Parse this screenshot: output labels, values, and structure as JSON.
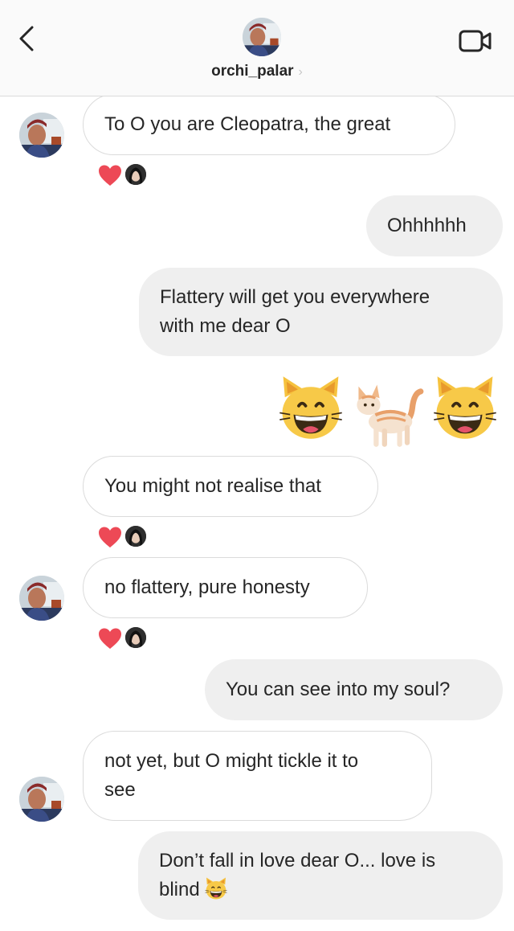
{
  "header": {
    "username": "orchi_palar",
    "chevron": "›",
    "back_icon": "chevron-left-icon",
    "video_icon": "video-camera-icon"
  },
  "colors": {
    "incoming_bubble": "#ffffff",
    "outgoing_bubble": "#efefef",
    "heart": "#ed4956"
  },
  "messages": [
    {
      "side": "in",
      "text": "To O you are Cleopatra, the great",
      "reaction": "heart"
    },
    {
      "side": "out",
      "text": "Ohhhhhh"
    },
    {
      "side": "out",
      "lines": [
        "Flattery will get you everywhere",
        "with me dear O"
      ]
    },
    {
      "side": "out",
      "emojis": [
        "grinning-cat-emoji",
        "cat-emoji",
        "grinning-cat-emoji"
      ]
    },
    {
      "side": "in",
      "text": "You might not realise that",
      "reaction": "heart"
    },
    {
      "side": "in",
      "text": "no flattery, pure honesty",
      "reaction": "heart"
    },
    {
      "side": "out",
      "text": "You can see into my soul?"
    },
    {
      "side": "in",
      "lines": [
        "not yet, but O might tickle it to",
        "see"
      ]
    },
    {
      "side": "out",
      "lines": [
        "Don’t fall in love dear O... love is",
        "blind"
      ],
      "trailing_emoji": "grinning-cat-emoji"
    }
  ]
}
